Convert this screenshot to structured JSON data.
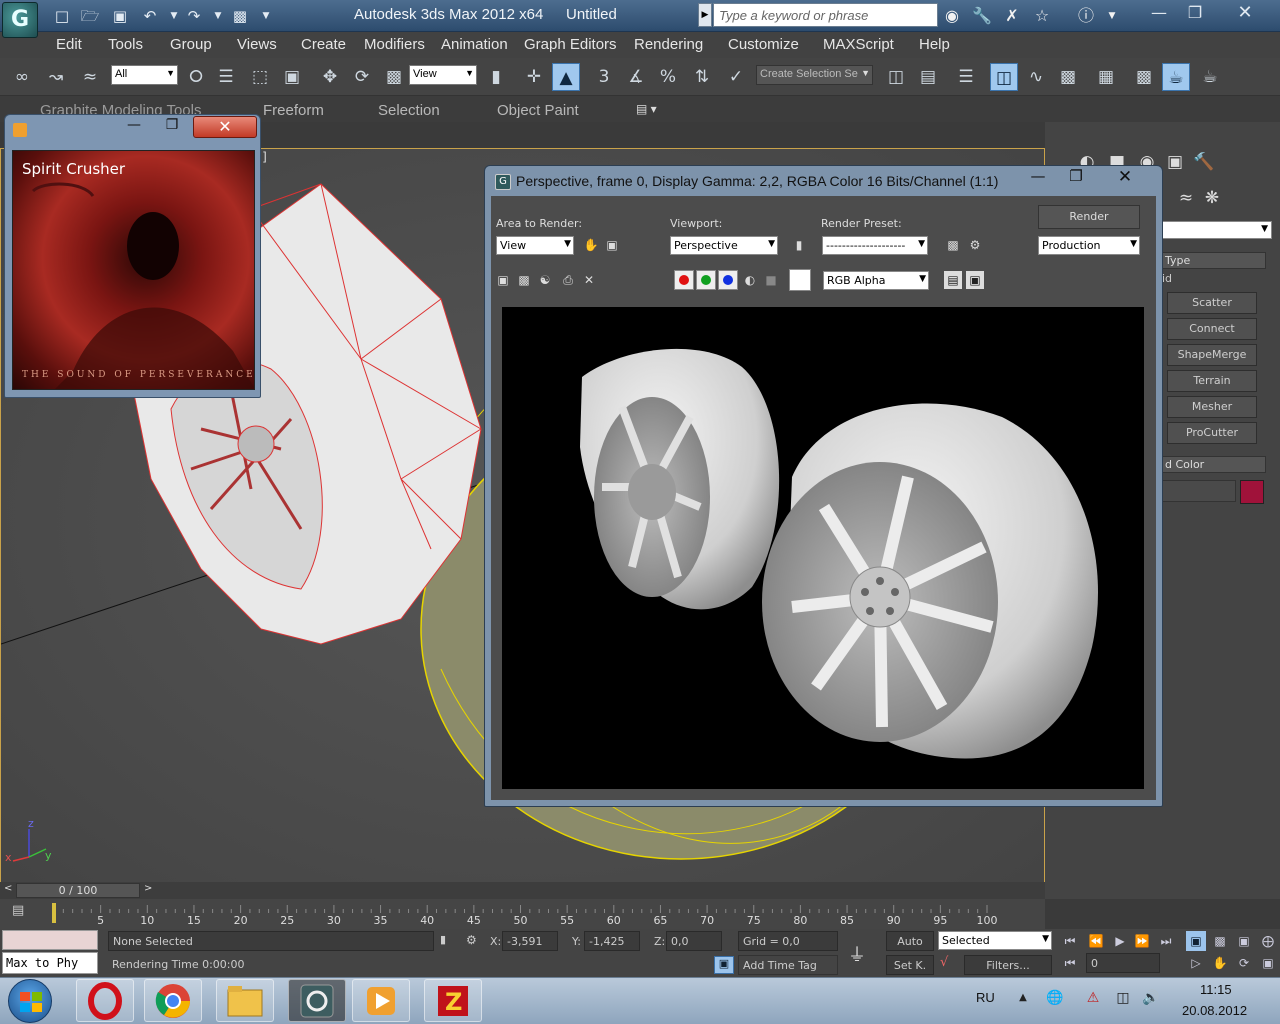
{
  "titlebar": {
    "app_icon_glyph": "G",
    "title": "Autodesk 3ds Max  2012 x64",
    "file": "Untitled",
    "search_placeholder": "Type a keyword or phrase",
    "icons": [
      "binoculars-icon",
      "wrench-icon",
      "tools-icon",
      "star-icon",
      "help-icon"
    ]
  },
  "menu": {
    "items": [
      "Edit",
      "Tools",
      "Group",
      "Views",
      "Create",
      "Modifiers",
      "Animation",
      "Graph Editors",
      "Rendering",
      "Customize",
      "MAXScript",
      "Help"
    ]
  },
  "toolbar": {
    "filter_value": "All",
    "ref_coord_value": "View",
    "selection_set_value": "Create Selection Se",
    "snap_labels": {
      "snap3": "3",
      "angle_snap": "%"
    }
  },
  "ribbon": {
    "tabs": [
      "Graphite Modeling Tools",
      "Freeform",
      "Selection",
      "Object Paint"
    ]
  },
  "viewport": {
    "label": "s ]",
    "axis_labels": {
      "z": "z",
      "x": "x",
      "y": "y"
    }
  },
  "command_panel": {
    "rollout_type": "Type",
    "rollout_color": "d Color",
    "object_type_partial": "id",
    "buttons": [
      "Scatter",
      "Connect",
      "ShapeMerge",
      "Terrain",
      "Mesher",
      "ProCutter"
    ],
    "object_color": "#a0123a"
  },
  "timeline": {
    "frame_label": "0 / 100",
    "ticks": [
      "5",
      "10",
      "15",
      "20",
      "25",
      "30",
      "35",
      "40",
      "45",
      "50",
      "55",
      "60",
      "65",
      "70",
      "75",
      "80",
      "85",
      "90",
      "95",
      "100"
    ]
  },
  "status": {
    "script_listener": "Max to Phy",
    "selection": "None Selected",
    "rendering_time": "Rendering Time  0:00:00",
    "x_label": "X:",
    "x_value": "-3,591",
    "y_label": "Y:",
    "y_value": "-1,425",
    "z_label": "Z:",
    "z_value": "0,0",
    "grid": "Grid = 0,0",
    "add_time_tag": "Add Time Tag",
    "auto_key": "Auto",
    "set_key": "Set K.",
    "key_filter_value": "Selected",
    "filters": "Filters...",
    "current_frame": "0"
  },
  "player": {
    "song": "Spirit Crusher",
    "album": "THE SOUND OF PERSEVERANCE"
  },
  "render_window": {
    "title": "Perspective, frame 0, Display Gamma: 2,2, RGBA Color 16 Bits/Channel (1:1)",
    "area_to_render_label": "Area to Render:",
    "area_to_render_value": "View",
    "viewport_label": "Viewport:",
    "viewport_value": "Perspective",
    "render_preset_label": "Render Preset:",
    "render_preset_value": "--------------------",
    "render_button": "Render",
    "production_value": "Production",
    "channel_value": "RGB Alpha"
  },
  "taskbar": {
    "apps": [
      "windows-start",
      "opera",
      "chrome",
      "explorer",
      "3dsmax",
      "media-player",
      "filezilla"
    ],
    "language": "RU",
    "time": "11:15",
    "date": "20.08.2012"
  }
}
